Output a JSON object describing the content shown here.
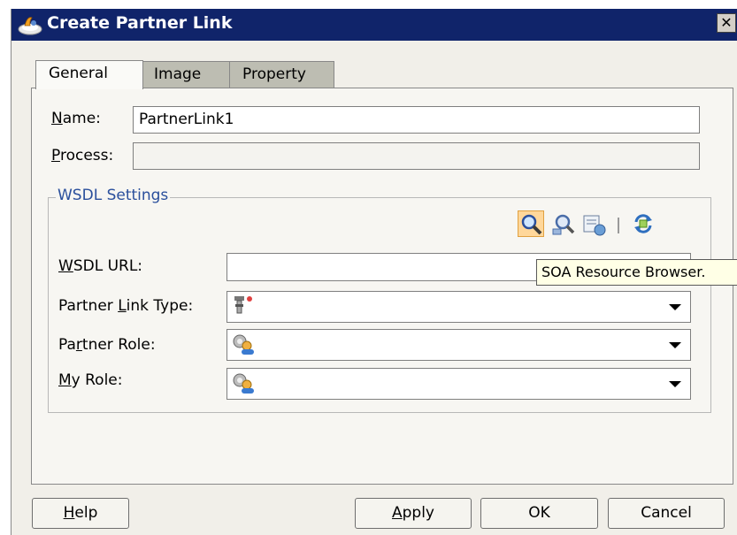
{
  "window": {
    "title": "Create Partner Link",
    "close_label": "✕"
  },
  "tabs": [
    {
      "label": "General",
      "active": true
    },
    {
      "label": "Image",
      "active": false
    },
    {
      "label": "Property",
      "active": false
    }
  ],
  "general": {
    "name_label": {
      "key": "N",
      "rest": "ame:"
    },
    "name_value": "PartnerLink1",
    "process_label": {
      "key": "P",
      "rest": "rocess:"
    },
    "process_value": ""
  },
  "wsdl_settings": {
    "title": "WSDL Settings",
    "toolbar_icons": [
      "search-icon",
      "service-explorer-icon",
      "resource-chooser-icon",
      "refresh-wsdl-icon"
    ],
    "wsdl_url_label": {
      "key": "W",
      "rest": "SDL URL:"
    },
    "wsdl_url_value": "",
    "tooltip": "SOA Resource Browser.",
    "partner_link_type_label": {
      "pre": "Partner ",
      "key": "L",
      "rest": "ink Type:"
    },
    "partner_role_label": {
      "pre": "Pa",
      "key": "r",
      "rest": "tner Role:"
    },
    "my_role_label": {
      "key": "M",
      "rest": "y Role:"
    }
  },
  "buttons": {
    "help": {
      "key": "H",
      "rest": "elp"
    },
    "apply": {
      "key": "A",
      "rest": "pply"
    },
    "ok": "OK",
    "cancel": "Cancel"
  },
  "colors": {
    "titlebar": "#10246a",
    "group_title": "#2a4f9c",
    "tooltip_bg": "#ffffe6"
  }
}
